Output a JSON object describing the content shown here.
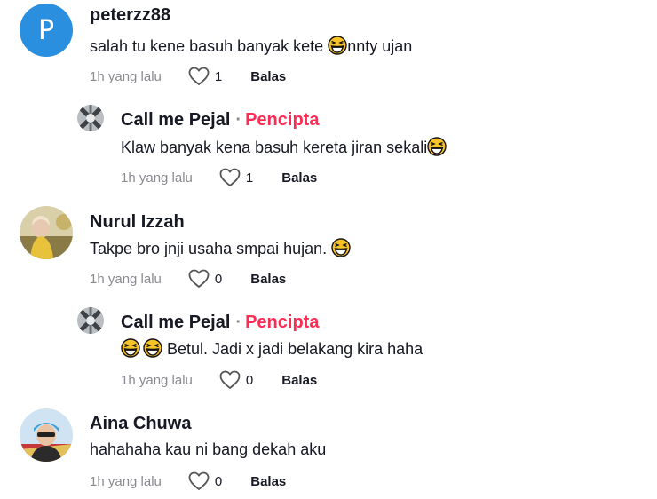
{
  "comments": [
    {
      "avatar_letter": "P",
      "author": "peterzz88",
      "text_before": "salah tu kene basuh banyak kete ",
      "text_after": "nnty ujan",
      "time": "1h yang lalu",
      "likes": "1",
      "reply_label": "Balas"
    },
    {
      "author": "Call me Pejal",
      "badge": "Pencipta",
      "text_before": "Klaw banyak kena basuh kereta jiran sekali",
      "time": "1h yang lalu",
      "likes": "1",
      "reply_label": "Balas"
    },
    {
      "author": "Nurul Izzah",
      "text_before": "Takpe bro jnji usaha smpai hujan. ",
      "time": "1h yang lalu",
      "likes": "0",
      "reply_label": "Balas"
    },
    {
      "author": "Call me Pejal",
      "badge": "Pencipta",
      "text_after": " Betul. Jadi x jadi belakang kira haha",
      "time": "1h yang lalu",
      "likes": "0",
      "reply_label": "Balas"
    },
    {
      "author": "Aina Chuwa",
      "text_before": "hahahaha kau ni bang dekah aku",
      "time": "1h yang lalu",
      "likes": "0",
      "reply_label": "Balas"
    }
  ],
  "colors": {
    "creator_badge": "#fe2c55",
    "meta_gray": "#8a8b91",
    "avatar_blue": "#2a8fde"
  },
  "icons": [
    "heart-outline-icon",
    "grinning-squinting-face-emoji"
  ]
}
